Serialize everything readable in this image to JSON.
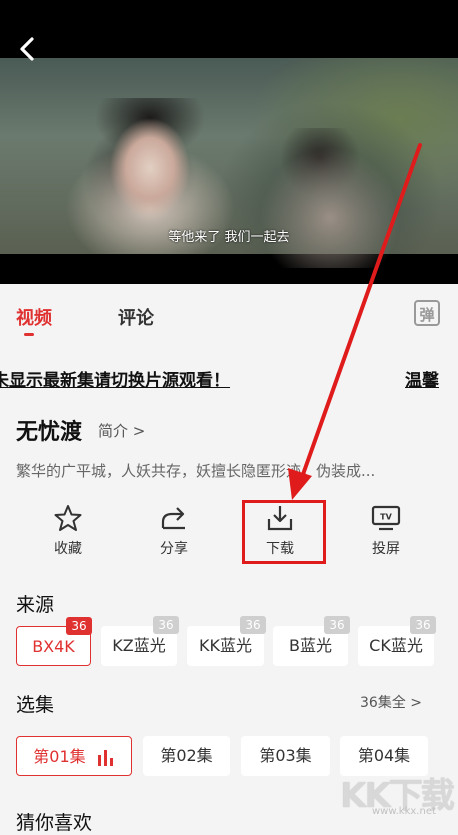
{
  "video": {
    "subtitle": "等他来了 我们一起去"
  },
  "tabs": [
    {
      "label": "视频"
    },
    {
      "label": "评论"
    }
  ],
  "danmaku": {
    "label": "弹"
  },
  "notice": {
    "text": "未显示最新集请切换片源观看！",
    "text2": "温馨"
  },
  "show": {
    "title": "无忧渡",
    "intro_label": "简介 >",
    "synopsis": "繁华的广平城，人妖共存，妖擅长隐匿形迹，伪装成..."
  },
  "actions": [
    {
      "label": "收藏",
      "icon": "star-icon"
    },
    {
      "label": "分享",
      "icon": "share-icon"
    },
    {
      "label": "下载",
      "icon": "download-icon"
    },
    {
      "label": "投屏",
      "icon": "tv-cast-icon"
    }
  ],
  "sources": {
    "heading": "来源",
    "items": [
      {
        "label": "BX4K",
        "badge": "36"
      },
      {
        "label": "KZ蓝光",
        "badge": "36"
      },
      {
        "label": "KK蓝光",
        "badge": "36"
      },
      {
        "label": "B蓝光",
        "badge": "36"
      },
      {
        "label": "CK蓝光",
        "badge": "36"
      }
    ]
  },
  "episodes": {
    "heading": "选集",
    "all_label": "36集全 >",
    "items": [
      {
        "label": "第01集"
      },
      {
        "label": "第02集"
      },
      {
        "label": "第03集"
      },
      {
        "label": "第04集"
      }
    ]
  },
  "recommend": {
    "heading": "猜你喜欢"
  },
  "watermark": {
    "big": "KK下载",
    "small": "www.kkx.net"
  },
  "colors": {
    "accent": "#e03131",
    "highlight": "#e01b1b"
  }
}
